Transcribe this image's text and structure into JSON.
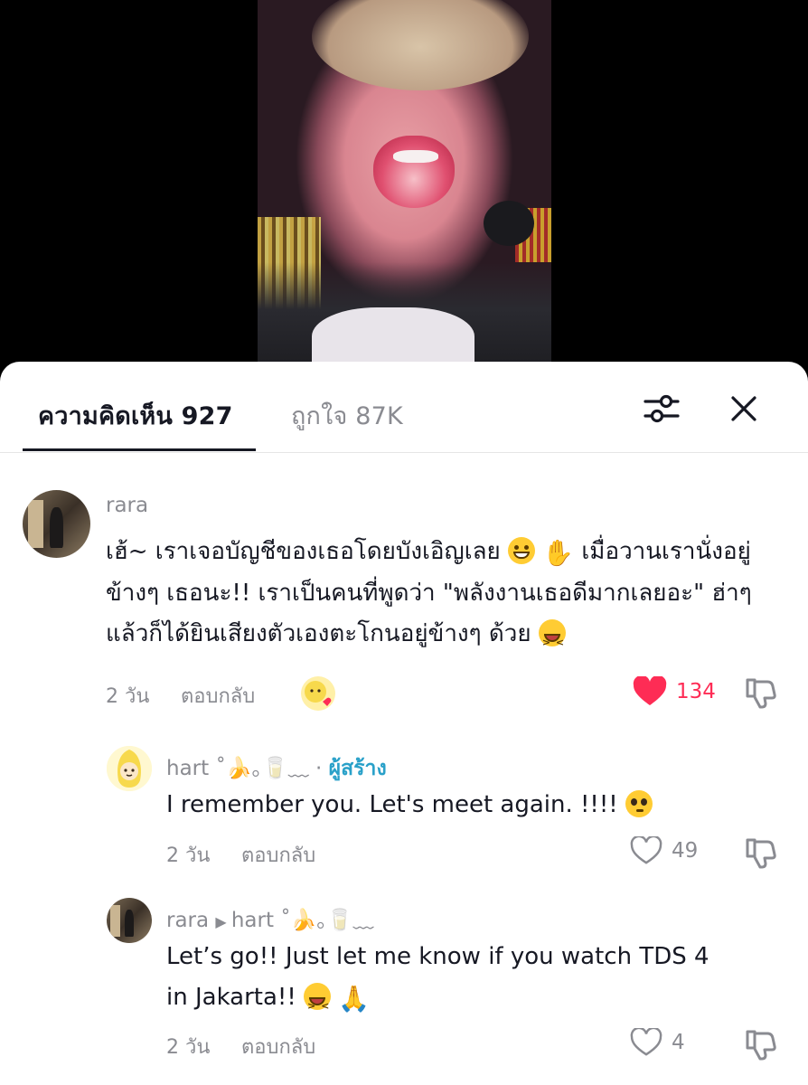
{
  "tabs": {
    "comments_label": "ความคิดเห็น 927",
    "likes_label": "ถูกใจ 87K"
  },
  "comments": [
    {
      "username": "rara",
      "text_part1": "เฮ้~ เราเจอบัญชีของเธอโดยบังเอิญเลย",
      "text_part2": "เมื่อวานเรานั่งอยู่ข้างๆ เธอนะ!! เราเป็นคนที่พูดว่า \"พลังงานเธอดีมากเลยอะ\" ฮ่าๆ แล้วก็ได้ยินเสียงตัวเองตะโกนอยู่ข้างๆ ด้วย",
      "time": "2 วัน",
      "reply_label": "ตอบกลับ",
      "likes": "134",
      "liked": true
    }
  ],
  "replies": [
    {
      "username": "hart ˚🍌｡🥛﹏",
      "creator_label": "ผู้สร้าง",
      "text": "I remember you. Let's meet again. !!!!",
      "time": "2 วัน",
      "reply_label": "ตอบกลับ",
      "likes": "49"
    },
    {
      "username": "rara",
      "reply_to": "hart ˚🍌｡🥛﹏",
      "text_line1": "Let’s go!! Just let me know if you watch TDS 4",
      "text_line2": "in Jakarta!!",
      "time": "2 วัน",
      "reply_label": "ตอบกลับ",
      "likes": "4"
    }
  ],
  "icons": {
    "filter": "sliders-icon",
    "close": "close-icon",
    "heart": "heart-icon",
    "dislike": "thumbs-down-icon"
  },
  "colors": {
    "accent_red": "#fe2c55",
    "creator_blue": "#2aa1c9",
    "text_primary": "#161823",
    "text_secondary": "#8a8b91"
  }
}
